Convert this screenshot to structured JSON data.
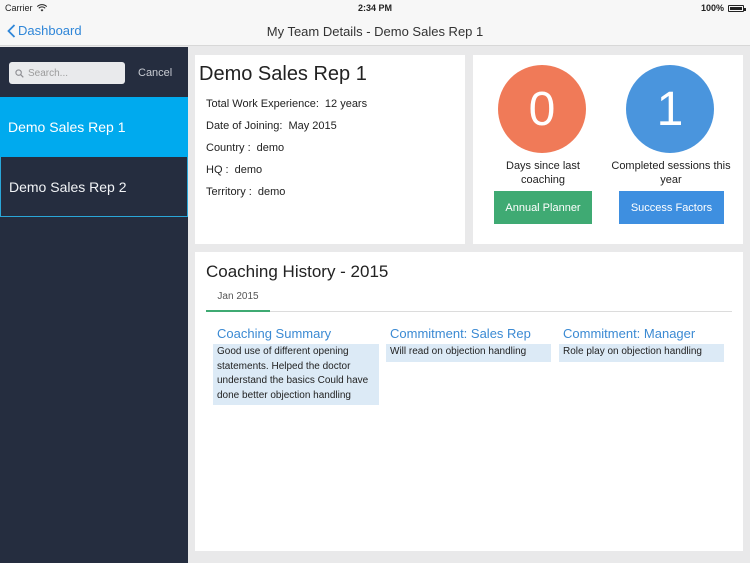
{
  "status": {
    "carrier": "Carrier",
    "time": "2:34 PM",
    "battery": "100%"
  },
  "nav": {
    "back_label": "Dashboard",
    "title": "My Team Details - Demo Sales Rep 1"
  },
  "sidebar": {
    "search_placeholder": "Search...",
    "cancel_label": "Cancel",
    "items": [
      {
        "label": "Demo Sales Rep 1",
        "selected": true
      },
      {
        "label": "Demo Sales Rep 2",
        "selected": false
      }
    ]
  },
  "rep": {
    "name": "Demo Sales Rep 1",
    "fields": [
      {
        "label": "Total Work Experience:",
        "value": "12 years"
      },
      {
        "label": "Date of Joining:",
        "value": "May 2015"
      },
      {
        "label": "Country :",
        "value": "demo"
      },
      {
        "label": "HQ :",
        "value": "demo"
      },
      {
        "label": "Territory :",
        "value": "demo"
      }
    ]
  },
  "stats": {
    "days_since_last_coaching": {
      "value": "0",
      "label": "Days since last coaching",
      "color": "#f07a58"
    },
    "completed_sessions": {
      "value": "1",
      "label": "Completed sessions this year",
      "color": "#4a95dd"
    },
    "annual_planner_label": "Annual Planner",
    "success_factors_label": "Success Factors"
  },
  "history": {
    "title": "Coaching History - 2015",
    "tabs": [
      "Jan 2015"
    ],
    "columns": [
      {
        "heading": "Coaching Summary",
        "text": "Good use of different opening statements. Helped the doctor understand the basics Could have done better objection handling"
      },
      {
        "heading": "Commitment: Sales Rep",
        "text": "Will read on objection handling"
      },
      {
        "heading": "Commitment: Manager",
        "text": "Role play on objection handling"
      }
    ]
  },
  "colors": {
    "accent": "#00aaee",
    "sidebar": "#252d3f",
    "green": "#3faa73",
    "link": "#2f86d8"
  }
}
